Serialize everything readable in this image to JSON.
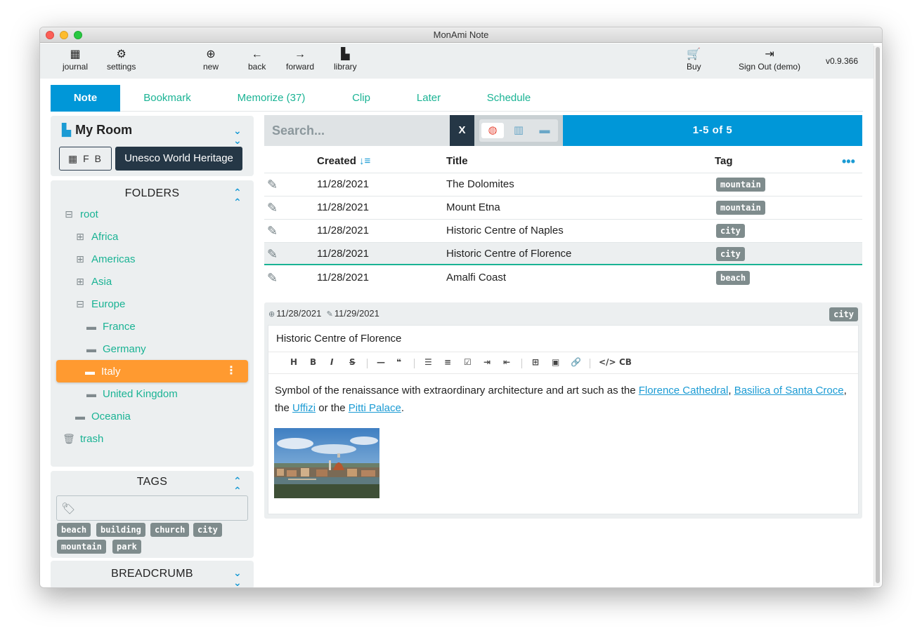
{
  "window": {
    "title": "MonAmi Note"
  },
  "toolbar": {
    "journal": "journal",
    "settings": "settings",
    "new": "new",
    "back": "back",
    "forward": "forward",
    "library": "library",
    "buy": "Buy",
    "signout": "Sign Out (demo)",
    "version": "v0.9.366"
  },
  "tabs": [
    "Note",
    "Bookmark",
    "Memorize (37)",
    "Clip",
    "Later",
    "Schedule"
  ],
  "room": {
    "title": "My Room",
    "fb_label": "F B",
    "heritage_button": "Unesco World Heritage"
  },
  "folders": {
    "heading": "FOLDERS",
    "items": [
      "root",
      "Africa",
      "Americas",
      "Asia",
      "Europe",
      "France",
      "Germany",
      "Italy",
      "United Kingdom",
      "Oceania",
      "trash"
    ]
  },
  "tags": {
    "heading": "TAGS",
    "chips": [
      "beach",
      "building",
      "church",
      "city",
      "mountain",
      "park"
    ]
  },
  "breadcrumb": {
    "heading": "BREADCRUMB"
  },
  "search": {
    "placeholder": "Search...",
    "clear": "X",
    "count": "1-5  of  5"
  },
  "table": {
    "headers": {
      "created": "Created",
      "title": "Title",
      "tag": "Tag"
    },
    "rows": [
      {
        "created": "11/28/2021",
        "title": "The Dolomites",
        "tag": "mountain"
      },
      {
        "created": "11/28/2021",
        "title": "Mount Etna",
        "tag": "mountain"
      },
      {
        "created": "11/28/2021",
        "title": "Historic Centre of Naples",
        "tag": "city"
      },
      {
        "created": "11/28/2021",
        "title": "Historic Centre of Florence",
        "tag": "city"
      },
      {
        "created": "11/28/2021",
        "title": "Amalfi Coast",
        "tag": "beach"
      }
    ]
  },
  "detail": {
    "created": "11/28/2021",
    "modified": "11/29/2021",
    "tag": "city",
    "title": "Historic Centre of Florence",
    "editor_buttons": [
      "H",
      "B",
      "I",
      "S",
      "—",
      "❝",
      "☰",
      "≡",
      "☑",
      "⇥",
      "⇤",
      "⊞",
      "▣",
      "🔗",
      "</>",
      "CB"
    ],
    "body": {
      "t1": "Symbol of the renaissance with extraordinary architecture and art such as the ",
      "l1": "Florence Cathedral",
      "t2": ", ",
      "l2": "Basilica of Santa Croce",
      "t3": ", the ",
      "l3": "Uffizi",
      "t4": " or the ",
      "l4": "Pitti Palace",
      "t5": "."
    }
  }
}
